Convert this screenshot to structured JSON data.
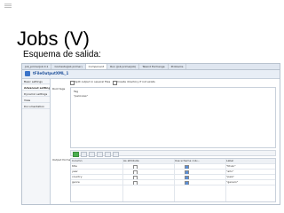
{
  "slide": {
    "title": "Jobs (V)",
    "subtitle": "Esquema de salida:"
  },
  "screenshot": {
    "tabs": [
      "Job_primerJob 0.1",
      "Contexts(Job primer)",
      "Component",
      "Run (Job primerJob)",
      "Talend Exchange",
      "Problems"
    ],
    "active_tab_index": 2,
    "component_name": "tFileOutputXML_1",
    "nav": [
      "Basic settings",
      "Advanced settings",
      "Dynamic settings",
      "View",
      "Documentation"
    ],
    "active_nav_index": 1,
    "options": {
      "split_label": "Split output in several files",
      "create_dir_label": "Create directory if not exists"
    },
    "root_tags_label": "Root tags",
    "root_tags": [
      "Tag",
      "\"peliculas\""
    ],
    "output_format_label": "Output format",
    "table": {
      "headers": [
        "Column",
        "As attribute",
        "Use schema colu...",
        "Label"
      ],
      "rows": [
        {
          "column": "title",
          "as_attribute": false,
          "use_schema": true,
          "label": "\"titulo\""
        },
        {
          "column": "year",
          "as_attribute": false,
          "use_schema": true,
          "label": "\"año\""
        },
        {
          "column": "country",
          "as_attribute": false,
          "use_schema": true,
          "label": "\"pais\""
        },
        {
          "column": "genre",
          "as_attribute": false,
          "use_schema": true,
          "label": "\"genero\""
        }
      ]
    }
  }
}
